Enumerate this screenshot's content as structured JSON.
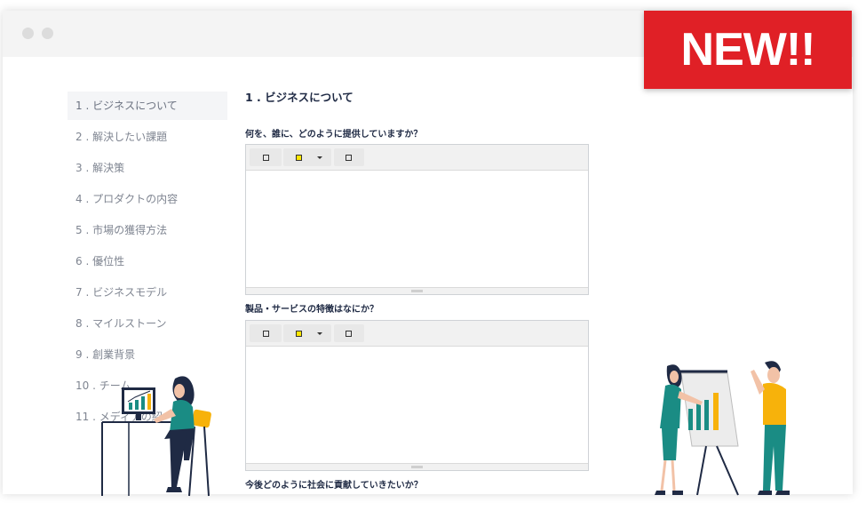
{
  "badge": {
    "label": "NEW!!"
  },
  "sidebar": {
    "items": [
      {
        "label": "1 . ビジネスについて"
      },
      {
        "label": "2 . 解決したい課題"
      },
      {
        "label": "3 . 解決策"
      },
      {
        "label": "4 . プロダクトの内容"
      },
      {
        "label": "5 . 市場の獲得方法"
      },
      {
        "label": "6 . 優位性"
      },
      {
        "label": "7 . ビジネスモデル"
      },
      {
        "label": "8 . マイルストーン"
      },
      {
        "label": "9 . 創業背景"
      },
      {
        "label": "10 . チーム"
      },
      {
        "label": "11 . メディアの紹"
      }
    ]
  },
  "main": {
    "section_title": "1 . ビジネスについて",
    "questions": [
      {
        "label": "何を、誰に、どのように提供していますか？"
      },
      {
        "label": "製品・サービスの特徴はなにか？"
      },
      {
        "label": "今後どのように社会に貢献していきたいか？"
      }
    ]
  },
  "colors": {
    "accent": "#e02026",
    "teal": "#1a8c84",
    "yellow": "#f7b20b",
    "navy": "#1f2a44"
  }
}
